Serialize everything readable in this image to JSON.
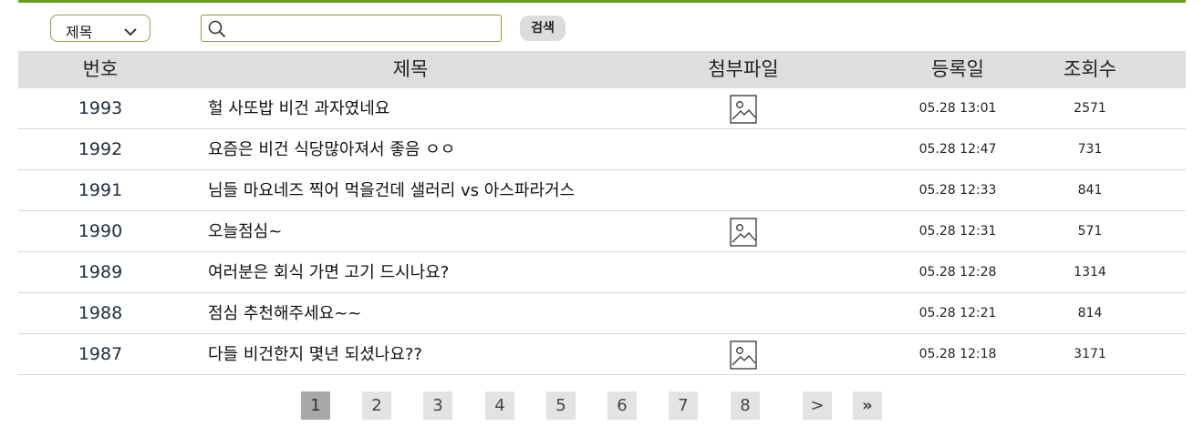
{
  "search": {
    "field_select": "제목",
    "query_value": "",
    "button_label": "검색"
  },
  "table": {
    "headers": {
      "no": "번호",
      "title": "제목",
      "file": "첨부파일",
      "date": "등록일",
      "views": "조회수"
    },
    "rows": [
      {
        "no": "1993",
        "title": "헐 사또밥 비건 과자였네요",
        "has_file": true,
        "date": "05.28 13:01",
        "views": "2571"
      },
      {
        "no": "1992",
        "title": "요즘은 비건 식당많아져서 좋음 ㅇㅇ",
        "has_file": false,
        "date": "05.28 12:47",
        "views": "731"
      },
      {
        "no": "1991",
        "title": "님들 마요네즈 찍어 먹을건데 샐러리 vs 아스파라거스",
        "has_file": false,
        "date": "05.28 12:33",
        "views": "841"
      },
      {
        "no": "1990",
        "title": "오늘점심~",
        "has_file": true,
        "date": "05.28 12:31",
        "views": "571"
      },
      {
        "no": "1989",
        "title": "여러분은 회식 가면 고기 드시나요?",
        "has_file": false,
        "date": "05.28 12:28",
        "views": "1314"
      },
      {
        "no": "1988",
        "title": "점심 추천해주세요~~",
        "has_file": false,
        "date": "05.28 12:21",
        "views": "814"
      },
      {
        "no": "1987",
        "title": "다들 비건한지 몇년 되셨나요??",
        "has_file": true,
        "date": "05.28 12:18",
        "views": "3171"
      }
    ]
  },
  "pagination": {
    "pages": [
      "1",
      "2",
      "3",
      "4",
      "5",
      "6",
      "7",
      "8"
    ],
    "current": "1",
    "next_label": ">",
    "last_label": "»"
  },
  "colors": {
    "accent_line": "#6e9e1f",
    "header_bg": "#dedede"
  },
  "icons": {
    "select_arrow": "chevron-down-icon",
    "search": "search-icon",
    "attachment": "image-icon"
  }
}
